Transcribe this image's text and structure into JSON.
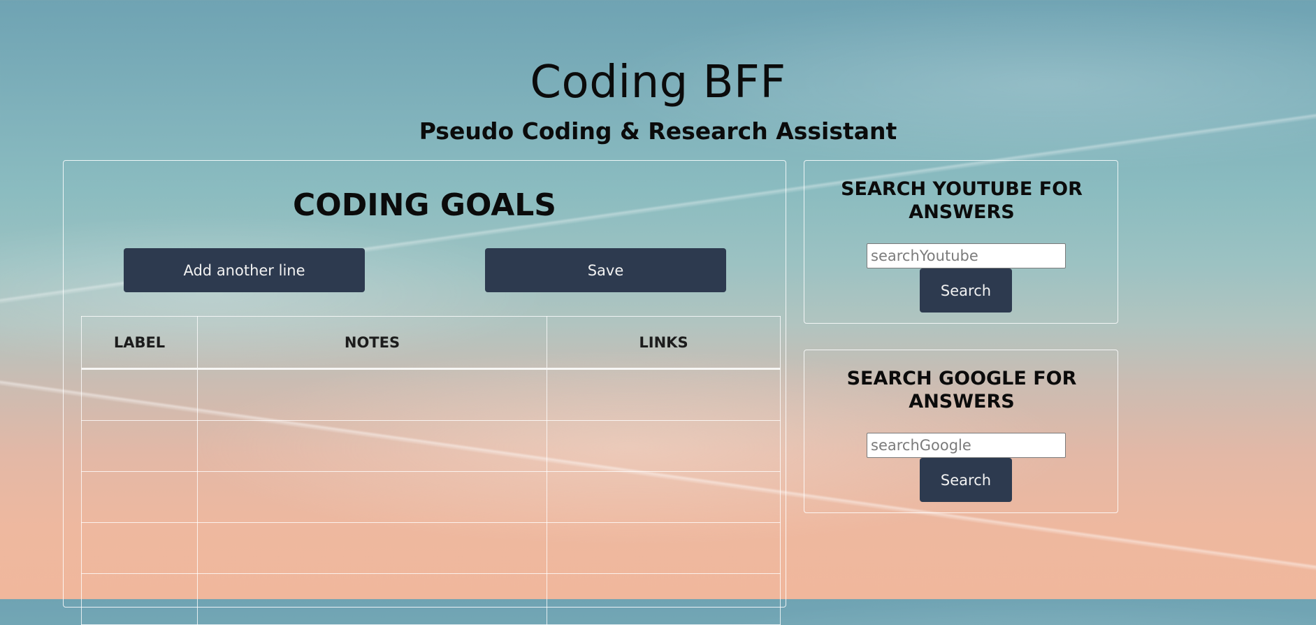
{
  "header": {
    "title": "Coding BFF",
    "subtitle": "Pseudo Coding & Research Assistant"
  },
  "goals": {
    "heading": "CODING GOALS",
    "add_line_label": "Add another line",
    "save_label": "Save",
    "table": {
      "columns": [
        "LABEL",
        "NOTES",
        "LINKS"
      ],
      "rows": [
        [
          "",
          "",
          ""
        ],
        [
          "",
          "",
          ""
        ],
        [
          "",
          "",
          ""
        ],
        [
          "",
          "",
          ""
        ],
        [
          "",
          "",
          ""
        ]
      ]
    }
  },
  "youtube_search": {
    "heading": "SEARCH YOUTUBE FOR ANSWERS",
    "placeholder": "searchYoutube",
    "value": "",
    "button_label": "Search"
  },
  "google_search": {
    "heading": "SEARCH GOOGLE FOR ANSWERS",
    "placeholder": "searchGoogle",
    "value": "",
    "button_label": "Search"
  },
  "colors": {
    "button_bg": "#2d3a4f",
    "button_text": "#f2f2f2",
    "panel_border": "#ffffff"
  }
}
